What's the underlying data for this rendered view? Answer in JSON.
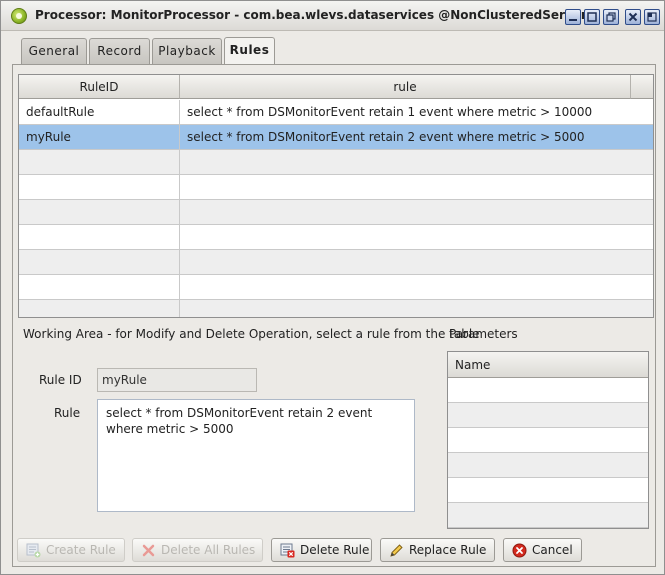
{
  "window": {
    "title": "Processor: MonitorProcessor - com.bea.wlevs.dataservices @NonClusteredServer"
  },
  "tabs": [
    {
      "label": "General"
    },
    {
      "label": "Record"
    },
    {
      "label": "Playback"
    },
    {
      "label": "Rules",
      "active": true
    }
  ],
  "rules_table": {
    "columns": [
      "RuleID",
      "rule"
    ],
    "rows": [
      {
        "rule_id": "defaultRule",
        "rule": "select * from DSMonitorEvent retain 1 event where metric > 10000"
      },
      {
        "rule_id": "myRule",
        "rule": "select * from DSMonitorEvent retain 2 event where metric > 5000",
        "selected": true
      }
    ]
  },
  "working_area": {
    "label": "Working Area - for Modify and Delete Operation, select a rule from the table",
    "rule_id_label": "Rule ID",
    "rule_id_value": "myRule",
    "rule_label": "Rule",
    "rule_value": "select * from DSMonitorEvent retain 2 event where metric > 5000"
  },
  "parameters": {
    "label": "Parameters",
    "column": "Name"
  },
  "buttons": {
    "create": "Create Rule",
    "delete_all": "Delete All Rules",
    "delete": "Delete Rule",
    "replace": "Replace Rule",
    "cancel": "Cancel"
  },
  "colors": {
    "selected_row": "#9dc3ea",
    "delete_red": "#d8261f",
    "cancel_red": "#d32a1e"
  }
}
